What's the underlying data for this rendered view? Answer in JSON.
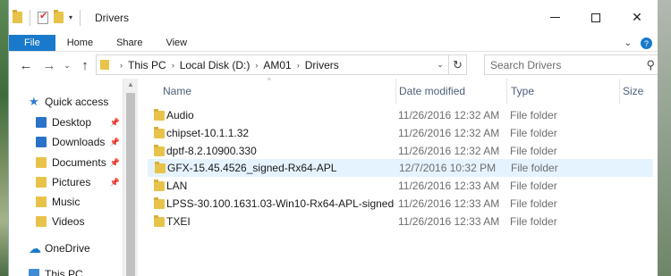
{
  "window": {
    "title": "Drivers",
    "controls": {
      "minimize": "—",
      "maximize": "☐",
      "close": "✕"
    }
  },
  "ribbon": {
    "tabs": [
      "File",
      "Home",
      "Share",
      "View"
    ],
    "expand_icon": "chevron-down-icon",
    "help_icon": "?"
  },
  "address": {
    "crumbs": [
      "This PC",
      "Local Disk (D:)",
      "AM01",
      "Drivers"
    ],
    "refresh_glyph": "↻"
  },
  "search": {
    "placeholder": "Search Drivers"
  },
  "nav": {
    "items": [
      {
        "label": "Quick access",
        "icon": "star-icon",
        "pinned": false
      },
      {
        "label": "Desktop",
        "icon": "desktop-folder-icon",
        "pinned": true
      },
      {
        "label": "Downloads",
        "icon": "downloads-folder-icon",
        "pinned": true
      },
      {
        "label": "Documents",
        "icon": "documents-folder-icon",
        "pinned": true
      },
      {
        "label": "Pictures",
        "icon": "pictures-folder-icon",
        "pinned": true
      },
      {
        "label": "Music",
        "icon": "music-folder-icon",
        "pinned": false
      },
      {
        "label": "Videos",
        "icon": "videos-folder-icon",
        "pinned": false
      },
      {
        "label": "OneDrive",
        "icon": "onedrive-icon",
        "pinned": false
      },
      {
        "label": "This PC",
        "icon": "this-pc-icon",
        "pinned": false
      }
    ]
  },
  "columns": {
    "name": "Name",
    "date": "Date modified",
    "type": "Type",
    "size": "Size"
  },
  "files": [
    {
      "name": "Audio",
      "date": "11/26/2016 12:32 AM",
      "type": "File folder",
      "selected": false
    },
    {
      "name": "chipset-10.1.1.32",
      "date": "11/26/2016 12:32 AM",
      "type": "File folder",
      "selected": false
    },
    {
      "name": "dptf-8.2.10900.330",
      "date": "11/26/2016 12:32 AM",
      "type": "File folder",
      "selected": false
    },
    {
      "name": "GFX-15.45.4526_signed-Rx64-APL",
      "date": "12/7/2016 10:32 PM",
      "type": "File folder",
      "selected": true
    },
    {
      "name": "LAN",
      "date": "11/26/2016 12:33 AM",
      "type": "File folder",
      "selected": false
    },
    {
      "name": "LPSS-30.100.1631.03-Win10-Rx64-APL-signed-...",
      "date": "11/26/2016 12:33 AM",
      "type": "File folder",
      "selected": false
    },
    {
      "name": "TXEI",
      "date": "11/26/2016 12:33 AM",
      "type": "File folder",
      "selected": false
    }
  ],
  "colors": {
    "accent": "#1979ca",
    "selection": "#e5f3ff",
    "folder": "#e8c34a",
    "header_text": "#4c607a"
  }
}
